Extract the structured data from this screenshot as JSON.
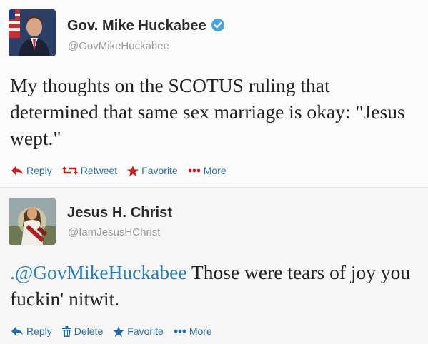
{
  "tweets": [
    {
      "name": "Gov. Mike Huckabee",
      "handle": "@GovMikeHuckabee",
      "verified": true,
      "text": "My thoughts on the SCOTUS ruling that determined that same sex marriage is okay: \"Jesus wept.\"",
      "actions": [
        "Reply",
        "Retweet",
        "Favorite",
        "More"
      ]
    },
    {
      "name": "Jesus H. Christ",
      "handle": "@IamJesusHChrist",
      "verified": false,
      "mention": ".@GovMikeHuckabee",
      "text": " Those were tears of joy you fuckin' nitwit.",
      "actions": [
        "Reply",
        "Delete",
        "Favorite",
        "More"
      ]
    }
  ],
  "colors": {
    "link": "#2a7fb8",
    "verified": "#4aa3df",
    "action_icon_1": "#c81e1e",
    "action_icon_2": "#1f6aa8"
  }
}
